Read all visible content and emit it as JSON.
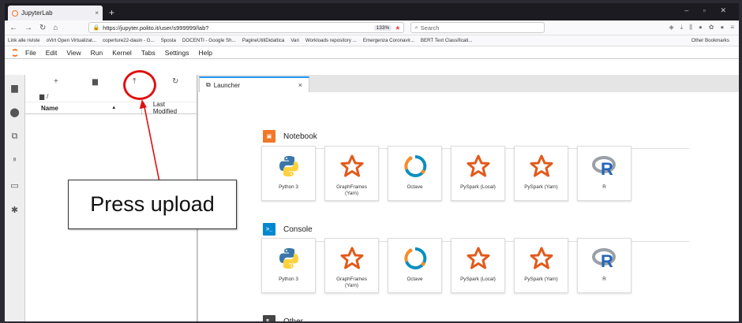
{
  "browser": {
    "tab_title": "JupyterLab",
    "tab_close": "×",
    "new_tab": "+",
    "url": "https://jupyter.polito.it/user/s999999/lab?",
    "zoom": "133%",
    "search_placeholder": "Search",
    "bookmarks": [
      "Link alle riviste",
      "oVirt Open Virtualizat...",
      "coperture22-dauin - G...",
      "Sposta",
      "DOCENTI - Google Sh...",
      "PagineUtiliDidattica",
      "Vari",
      "Workloads repository ...",
      "Emergenza Coronavir...",
      "BERT Text Classificati..."
    ],
    "other_bookmarks": "Other Bookmarks"
  },
  "menu": [
    "File",
    "Edit",
    "View",
    "Run",
    "Kernel",
    "Tabs",
    "Settings",
    "Help"
  ],
  "file_browser": {
    "breadcrumb": "/",
    "col_name": "Name",
    "col_sort": "▲",
    "col_modified": "Last Modified"
  },
  "launcher": {
    "tab_label": "Launcher",
    "tab_close": "×",
    "sections": [
      {
        "title": "Notebook",
        "color": "#f37726",
        "kernels": [
          {
            "label": "Python 3",
            "icon": "python-icon"
          },
          {
            "label": "GraphFrames (Yarn)",
            "icon": "spark-star-icon"
          },
          {
            "label": "Octave",
            "icon": "octave-icon"
          },
          {
            "label": "PySpark (Local)",
            "icon": "spark-star-icon"
          },
          {
            "label": "PySpark (Yarn)",
            "icon": "spark-star-icon"
          },
          {
            "label": "R",
            "icon": "r-logo-icon"
          }
        ]
      },
      {
        "title": "Console",
        "color": "#0288d1",
        "kernels": [
          {
            "label": "Python 3",
            "icon": "python-icon"
          },
          {
            "label": "GraphFrames (Yarn)",
            "icon": "spark-star-icon"
          },
          {
            "label": "Octave",
            "icon": "octave-icon"
          },
          {
            "label": "PySpark (Local)",
            "icon": "spark-star-icon"
          },
          {
            "label": "PySpark (Yarn)",
            "icon": "spark-star-icon"
          },
          {
            "label": "R",
            "icon": "r-logo-icon"
          }
        ]
      },
      {
        "title": "Other",
        "color": "#444444"
      }
    ]
  },
  "annotation": {
    "text": "Press upload",
    "color": "#e01010"
  }
}
